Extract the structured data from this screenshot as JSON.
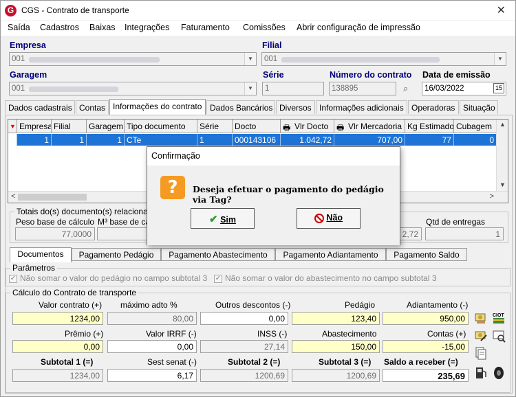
{
  "window": {
    "title": "CGS - Contrato de transporte",
    "logo_letter": "G"
  },
  "menu": [
    "Saída",
    "Cadastros",
    "Baixas",
    "Integrações",
    "Faturamento",
    "Comissões",
    "Abrir configuração de impressão"
  ],
  "header": {
    "empresa_label": "Empresa",
    "empresa_value": "001",
    "filial_label": "Filial",
    "filial_value": "001",
    "garagem_label": "Garagem",
    "garagem_value": "001",
    "serie_label": "Série",
    "serie_value": "1",
    "numero_label": "Número do contrato",
    "numero_value": "138895",
    "data_label": "Data de emissão",
    "data_value": "16/03/2022"
  },
  "tabs": [
    "Dados cadastrais",
    "Contas",
    "Informações do contrato",
    "Dados Bancários",
    "Diversos",
    "Informações adicionais",
    "Operadoras",
    "Situação"
  ],
  "grid": {
    "columns": [
      "Empresa",
      "Filial",
      "Garagem",
      "Tipo documento",
      "Série",
      "Docto",
      "Vlr Docto",
      "Vlr Mercadoria",
      "Kg Estimado",
      "Cubagem"
    ],
    "rows": [
      [
        "1",
        "1",
        "1",
        "CTe",
        "1",
        "000143106",
        "1.042,72",
        "707,00",
        "77",
        "0"
      ]
    ]
  },
  "totals": {
    "title": "Totais do(s) documento(s) relacionad",
    "peso_label": "Peso base de cálculo",
    "peso_value": "77,0000",
    "m3_label": "M³ base de cá",
    "partial_value": "2,72",
    "entregas_label": "Qtd de entregas",
    "entregas_value": "1"
  },
  "bottom_tabs": [
    "Documentos",
    "Pagamento Pedágio",
    "Pagamento Abastecimento",
    "Pagamento Adiantamento",
    "Pagamento Saldo"
  ],
  "parametros": {
    "title": "Parâmetros",
    "opt1": "Não somar o valor do pedágio no campo subtotal 3",
    "opt2": "Não somar o valor do abastecimento no campo subtotal 3"
  },
  "calculo": {
    "title": "Cálculo do Contrato de transporte",
    "valor_contrato_label": "Valor contrato (+)",
    "valor_contrato": "1234,00",
    "max_adto_label": "máximo adto %",
    "max_adto": "80,00",
    "outros_desc_label": "Outros descontos (-)",
    "outros_desc": "0,00",
    "pedagio_label": "Pedágio",
    "pedagio": "123,40",
    "adiantamento_label": "Adiantamento (-)",
    "adiantamento": "950,00",
    "premio_label": "Prêmio (+)",
    "premio": "0,00",
    "irrf_label": "Valor IRRF (-)",
    "irrf": "0,00",
    "inss_label": "INSS (-)",
    "inss": "27,14",
    "abastecimento_label": "Abastecimento",
    "abastecimento": "150,00",
    "contas_label": "Contas (+)",
    "contas": "-15,00",
    "subtotal1_label": "Subtotal 1 (=)",
    "subtotal1": "1234,00",
    "sest_label": "Sest senat (-)",
    "sest": "6,17",
    "subtotal2_label": "Subtotal 2 (=)",
    "subtotal2": "1200,69",
    "subtotal3_label": "Subtotal 3 (=)",
    "subtotal3": "1200,69",
    "saldo_label": "Saldo a receber (=)",
    "saldo": "235,69",
    "ciot_label": "CIOT"
  },
  "dialog": {
    "title": "Confirmação",
    "icon": "?",
    "message": "Deseja efetuar o pagamento do pedágio via Tag?",
    "yes_label": "Sim",
    "no_label": "Não"
  }
}
